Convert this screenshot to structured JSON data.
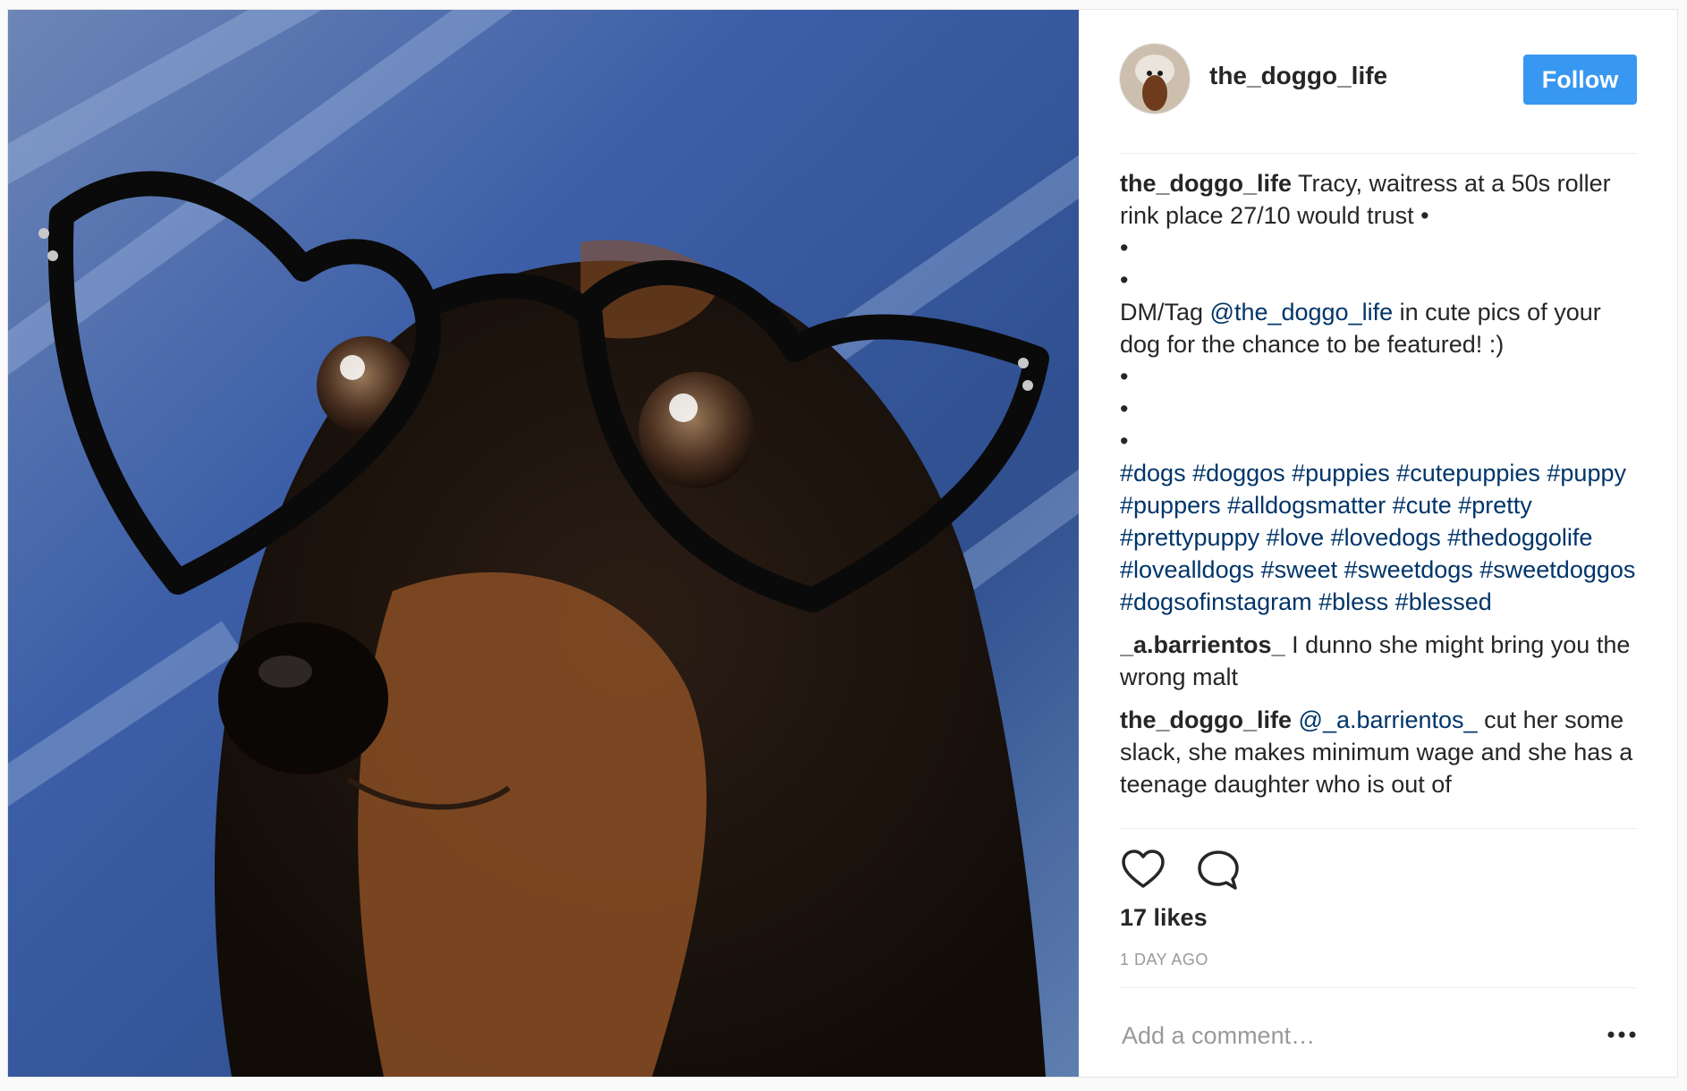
{
  "post": {
    "image_alt": "Dachshund wearing black heart-shaped glasses",
    "username": "the_doggo_life",
    "follow_label": "Follow",
    "caption": {
      "username": "the_doggo_life",
      "line1": "Tracy, waitress at a 50s roller rink place 27/10 would trust •",
      "bullet_a": "•",
      "bullet_b": "•",
      "dm_prefix": "DM/Tag ",
      "mention": "@the_doggo_life",
      "dm_suffix": " in cute pics of your dog for the chance to be featured! :)",
      "bullet_c": "•",
      "bullet_d": "•",
      "bullet_e": "•",
      "hashtags": "#dogs #doggos #puppies #cutepuppies #puppy #puppers #alldogsmatter #cute #pretty #prettypuppy #love #lovedogs #thedoggolife #lovealldogs #sweet #sweetdogs #sweetdoggos #dogsofinstagram #bless #blessed"
    },
    "comments": [
      {
        "username": "_a.barrientos_",
        "text": "I dunno she might bring you the wrong malt"
      },
      {
        "username": "the_doggo_life",
        "mention": "@_a.barrientos_",
        "text": "cut her some slack, she makes minimum wage and she has a teenage daughter who is out of"
      }
    ],
    "likes": "17 likes",
    "time": "1 DAY AGO",
    "comment_placeholder": "Add a comment…",
    "icons": {
      "like": "heart-icon",
      "comment": "speech-bubble-icon",
      "more": "ellipsis-icon"
    },
    "colors": {
      "follow_button": "#3897f0",
      "link": "#003569",
      "muted": "#999999"
    }
  }
}
